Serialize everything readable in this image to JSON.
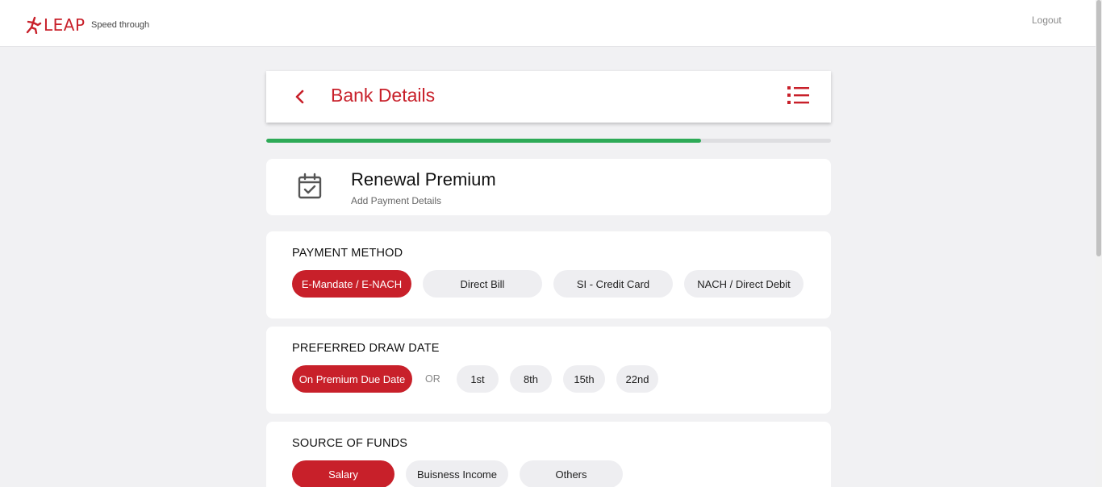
{
  "topbar": {
    "logo_text": "LEAP",
    "tagline": "Speed through",
    "logout_label": "Logout"
  },
  "header": {
    "title": "Bank Details",
    "back_icon": "chevron-left-icon",
    "menu_icon": "list-menu-icon"
  },
  "progress": {
    "percent": 77
  },
  "info": {
    "title": "Renewal Premium",
    "subtitle": "Add Payment Details",
    "icon": "calendar-check-icon"
  },
  "payment_method": {
    "title": "PAYMENT METHOD",
    "options": [
      "E-Mandate / E-NACH",
      "Direct Bill",
      "SI - Credit Card",
      "NACH / Direct Debit"
    ],
    "selected": 0
  },
  "draw_date": {
    "title": "PREFERRED DRAW DATE",
    "primary_option": "On Premium Due Date",
    "or_label": "OR",
    "options": [
      "1st",
      "8th",
      "15th",
      "22nd"
    ]
  },
  "source_of_funds": {
    "title": "SOURCE OF FUNDS",
    "options": [
      "Salary",
      "Buisness Income",
      "Others"
    ],
    "selected": 0
  },
  "colors": {
    "brand": "#c8202a",
    "progress": "#2eaa57",
    "background": "#f1f1f3"
  }
}
